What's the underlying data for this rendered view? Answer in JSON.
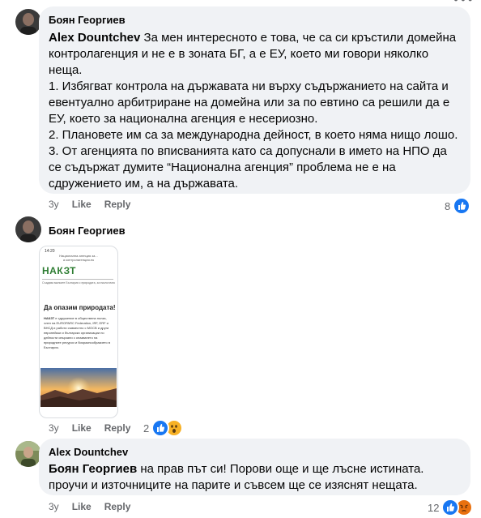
{
  "comments": [
    {
      "author": "Боян Георгиев",
      "mention": "Alex Dountchev",
      "text_after_mention": " За мен интересното е това, че са си кръстили домейна контролагенция и не е в зоната БГ, а е ЕУ, което ми говори няколко неща.",
      "line1": "1. Избягват контрола на държавата ни върху съдържанието на сайта и евентуално арбитриране на домейна или за по евтино са решили да е ЕУ, което за национална агенция е несериозно.",
      "line2": "2. Плановете им са за международна дейност, в което няма нищо лошо.",
      "line3": "3. От агенцията по вписванията като са допуснали в името на НПО да се съдържат думите “Национална агенция” проблема не е на сдружението им, а на държавата.",
      "time": "3y",
      "like": "Like",
      "reply": "Reply",
      "reaction_count": "8"
    },
    {
      "author": "Боян Георгиев",
      "time": "3y",
      "like": "Like",
      "reply": "Reply",
      "reaction_count": "2",
      "image": {
        "status_time": "14:20",
        "url_title": "Национална агенция за...",
        "url_domain": "а контролагенция.eu",
        "logo": "НАКЗТ",
        "tagline": "Създава малките България с природата, за екологично развитие",
        "heading": "Да опазим природата!",
        "paragraph_start": "НАКЗТ",
        "paragraph": " е сдружение в обществена полза, член на EUROPARC Federation, IRF, ERF и ВНСД и работи съвместно с МОСВ и други европейски и български организации по дейности свързани с опазването на природните ресурси и биоразнообразието в България."
      }
    },
    {
      "author": "Alex Dountchev",
      "mention": "Боян Георгиев",
      "text_after_mention": " на прав път си! Порови още и ще лъсне истината. проучи и източниците на парите и съвсем ще се изяснят нещата.",
      "time": "3y",
      "like": "Like",
      "reply": "Reply",
      "reaction_count": "12"
    }
  ],
  "colors": {
    "like_blue": "#1877f2",
    "wow_yellow": "#f7b125",
    "angry_red": "#e9710f",
    "bubble": "#f0f2f5",
    "meta_gray": "#65676b",
    "logo_green": "#2e7d32"
  },
  "icons": [
    "like-reaction-icon",
    "wow-reaction-icon",
    "angry-reaction-icon",
    "more-options-icon"
  ]
}
